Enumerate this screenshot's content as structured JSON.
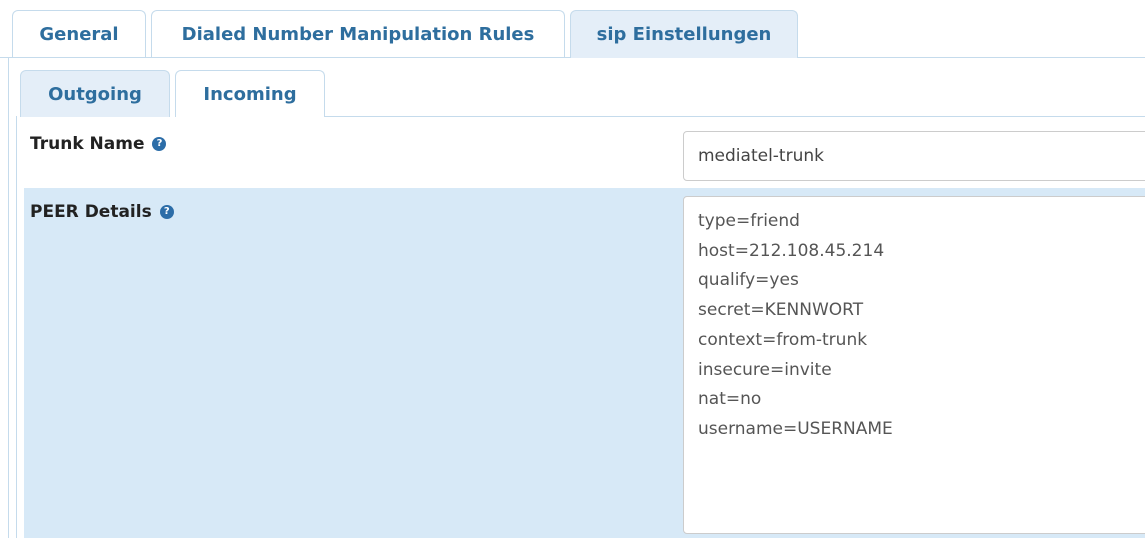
{
  "top_tabs": [
    {
      "label": "General"
    },
    {
      "label": "Dialed Number Manipulation Rules"
    },
    {
      "label": "sip Einstellungen"
    }
  ],
  "sub_tabs": [
    {
      "label": "Outgoing"
    },
    {
      "label": "Incoming"
    }
  ],
  "form": {
    "trunk_name": {
      "label": "Trunk Name",
      "value": "mediatel-trunk"
    },
    "peer_details": {
      "label": "PEER Details",
      "value": "type=friend\nhost=212.108.45.214\nqualify=yes\nsecret=KENNWORT\ncontext=from-trunk\ninsecure=invite\nnat=no\nusername=USERNAME"
    }
  },
  "icons": {
    "help": "question-circle-icon"
  },
  "colors": {
    "tab_text": "#2e6e9e",
    "tab_border": "#c5dbec",
    "active_tab_bg": "#e4eef8",
    "highlight_row_bg": "#d7e9f7",
    "help_icon": "#2c6da8"
  }
}
